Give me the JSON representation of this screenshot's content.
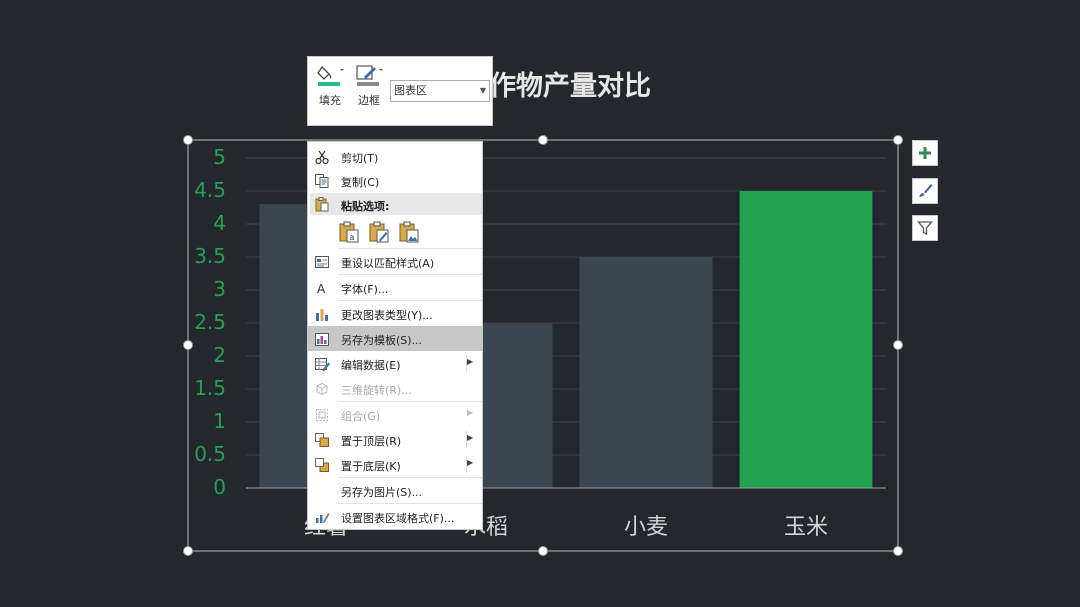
{
  "chart_data": {
    "type": "bar",
    "title": "作物产量对比",
    "categories": [
      "红薯",
      "水稻",
      "小麦",
      "玉米"
    ],
    "values": [
      4.3,
      2.5,
      3.5,
      4.5
    ],
    "ylim": [
      0,
      5
    ],
    "yticks": [
      "0",
      "0.5",
      "1",
      "1.5",
      "2",
      "2.5",
      "3",
      "3.5",
      "4",
      "4.5",
      "5"
    ],
    "grid": true,
    "colors": {
      "default": "#3b4650",
      "highlight": "#22a24e",
      "gridline": "#3e4349",
      "axis_tick": "#27a050"
    },
    "highlight_index": 3
  },
  "mini_toolbar": {
    "fill_label": "填充",
    "border_label": "边框",
    "element_select": "图表区"
  },
  "context_menu": {
    "cut": "剪切(T)",
    "copy": "复制(C)",
    "paste_options": "粘贴选项:",
    "reset_style": "重设以匹配样式(A)",
    "font": "字体(F)...",
    "change_type": "更改图表类型(Y)...",
    "save_template": "另存为模板(S)...",
    "edit_data": "编辑数据(E)",
    "rotate_3d": "三维旋转(R)...",
    "group": "组合(G)",
    "bring_front": "置于顶层(R)",
    "send_back": "置于底层(K)",
    "save_picture": "另存为图片(S)...",
    "format_area": "设置图表区域格式(F)..."
  },
  "side_buttons": [
    "plus-icon",
    "brush-icon",
    "filter-icon"
  ]
}
